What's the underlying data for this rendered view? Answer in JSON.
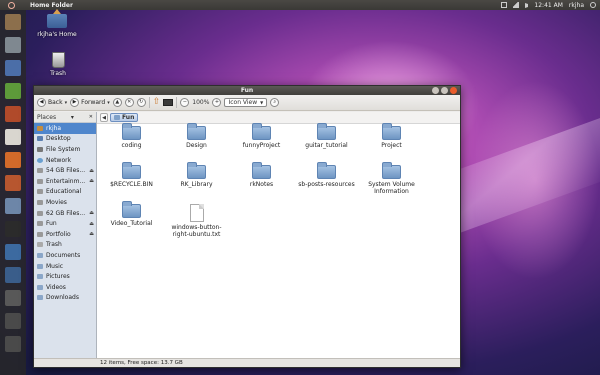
{
  "top_panel": {
    "title": "Home Folder",
    "clock": "12:41 AM",
    "user": "rkjha",
    "tray_icons": [
      "mail-icon",
      "network-icon",
      "volume-icon",
      "power-icon"
    ]
  },
  "launcher": {
    "items": [
      {
        "name": "home-folder-icon",
        "color": "#8c6f4c"
      },
      {
        "name": "settings-icon",
        "color": "#7f8890"
      },
      {
        "name": "writer-icon",
        "color": "#4b6ea8"
      },
      {
        "name": "calc-icon",
        "color": "#5d9a3a"
      },
      {
        "name": "impress-icon",
        "color": "#b04a2a"
      },
      {
        "name": "text-editor-icon",
        "color": "#d9d6cf"
      },
      {
        "name": "firefox-icon",
        "color": "#d16a2a"
      },
      {
        "name": "software-center-icon",
        "color": "#b7562f"
      },
      {
        "name": "files-icon",
        "color": "#6d86a8"
      },
      {
        "name": "terminal-icon",
        "color": "#2b2b2b"
      },
      {
        "name": "paint-icon",
        "color": "#3c6aa0"
      },
      {
        "name": "media-icon",
        "color": "#3a5d8a"
      },
      {
        "name": "camera-icon",
        "color": "#585858"
      },
      {
        "name": "workspace-icon",
        "color": "#4a4a4a"
      },
      {
        "name": "trash-launcher-icon",
        "color": "#4a4a4a"
      }
    ]
  },
  "desktop": {
    "home_label": "rkjha's Home",
    "trash_label": "Trash"
  },
  "window": {
    "title": "Fun",
    "toolbar": {
      "back_label": "Back",
      "forward_label": "Forward",
      "zoom": "100%",
      "view_mode": "Icon View"
    },
    "sidebar": {
      "header": "Places",
      "items": [
        {
          "label": "rkjha",
          "icon": "home-icon",
          "selected": true,
          "eject": false
        },
        {
          "label": "Desktop",
          "icon": "desktop-icon",
          "selected": false,
          "eject": false
        },
        {
          "label": "File System",
          "icon": "filesystem-icon",
          "selected": false,
          "eject": false
        },
        {
          "label": "Network",
          "icon": "network-icon",
          "selected": false,
          "eject": false
        },
        {
          "label": "54 GB Files...",
          "icon": "drive-icon",
          "selected": false,
          "eject": true
        },
        {
          "label": "Entertainm...",
          "icon": "drive-icon",
          "selected": false,
          "eject": true
        },
        {
          "label": "Educational",
          "icon": "drive-icon",
          "selected": false,
          "eject": false
        },
        {
          "label": "Movies",
          "icon": "drive-icon",
          "selected": false,
          "eject": false
        },
        {
          "label": "62 GB Files...",
          "icon": "drive-icon",
          "selected": false,
          "eject": true
        },
        {
          "label": "Fun",
          "icon": "drive-icon",
          "selected": false,
          "eject": true
        },
        {
          "label": "Portfolio",
          "icon": "drive-icon",
          "selected": false,
          "eject": true
        },
        {
          "label": "Trash",
          "icon": "trash-icon",
          "selected": false,
          "eject": false
        },
        {
          "label": "Documents",
          "icon": "folder-icon",
          "selected": false,
          "eject": false
        },
        {
          "label": "Music",
          "icon": "folder-icon",
          "selected": false,
          "eject": false
        },
        {
          "label": "Pictures",
          "icon": "folder-icon",
          "selected": false,
          "eject": false
        },
        {
          "label": "Videos",
          "icon": "folder-icon",
          "selected": false,
          "eject": false
        },
        {
          "label": "Downloads",
          "icon": "folder-icon",
          "selected": false,
          "eject": false
        }
      ]
    },
    "path": [
      "Fun"
    ],
    "files": [
      {
        "name": "coding",
        "type": "folder"
      },
      {
        "name": "Design",
        "type": "folder"
      },
      {
        "name": "funnyProject",
        "type": "folder"
      },
      {
        "name": "guitar_tutorial",
        "type": "folder"
      },
      {
        "name": "Project",
        "type": "folder"
      },
      {
        "name": "$RECYCLE.BIN",
        "type": "folder"
      },
      {
        "name": "RK_Library",
        "type": "folder"
      },
      {
        "name": "rkNotes",
        "type": "folder"
      },
      {
        "name": "sb-posts-resources",
        "type": "folder"
      },
      {
        "name": "System Volume Information",
        "type": "folder"
      },
      {
        "name": "Video_Tutorial",
        "type": "folder"
      },
      {
        "name": "windows-button-right-ubuntu.txt",
        "type": "file"
      }
    ],
    "status": "12 items, Free space: 13.7 GB"
  }
}
